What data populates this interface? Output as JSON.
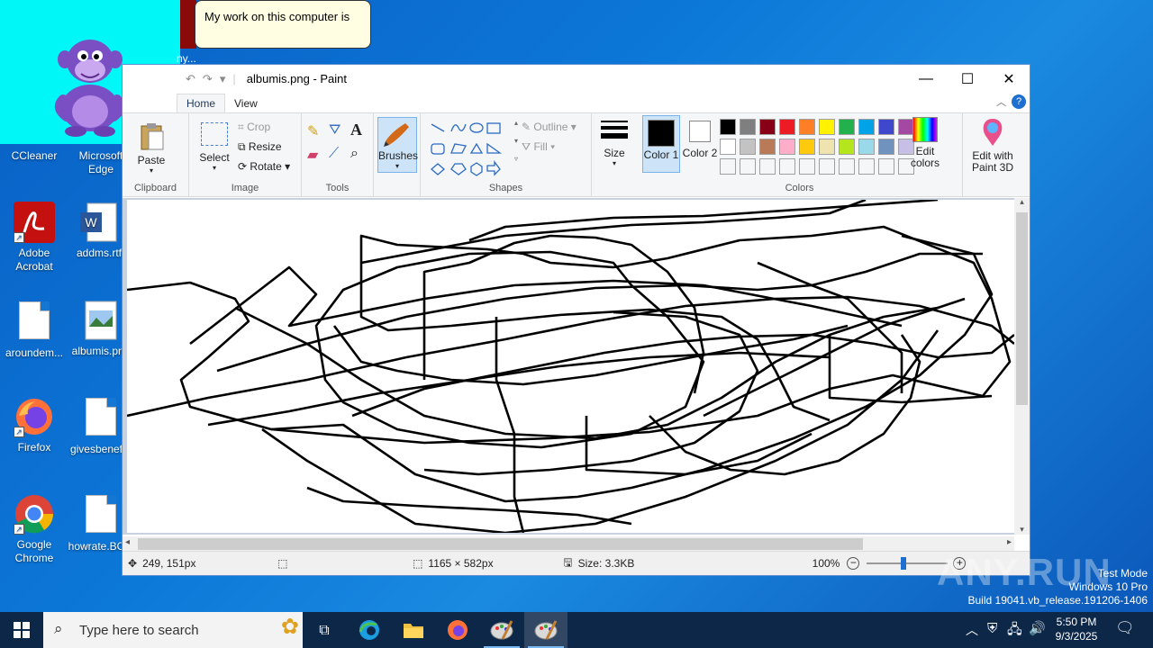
{
  "bonzi": {
    "bubble_text": "My work on this computer is",
    "tail_text": "ny..."
  },
  "desktop": {
    "icons": [
      {
        "label": "CCleaner"
      },
      {
        "label": "Microsoft Edge"
      },
      {
        "label": "Adobe Acrobat"
      },
      {
        "label": "addms.rtf"
      },
      {
        "label": "aroundem..."
      },
      {
        "label": "albumis.png"
      },
      {
        "label": "Firefox"
      },
      {
        "label": "givesbenef..."
      },
      {
        "label": "Google Chrome"
      },
      {
        "label": "howrate.BC..."
      }
    ]
  },
  "paint": {
    "title": "albumis.png - Paint",
    "tabs": [
      "Home",
      "View"
    ],
    "groups": {
      "clipboard": {
        "label": "Clipboard",
        "paste": "Paste"
      },
      "image": {
        "label": "Image",
        "select": "Select",
        "crop": "Crop",
        "resize": "Resize",
        "rotate": "Rotate"
      },
      "tools": {
        "label": "Tools"
      },
      "brushes": {
        "label": "Brushes"
      },
      "shapes": {
        "label": "Shapes",
        "outline": "Outline",
        "fill": "Fill"
      },
      "size": {
        "label": "Size"
      },
      "colors": {
        "label": "Colors",
        "color1": "Color 1",
        "color2": "Color 2",
        "edit_colors": "Edit colors"
      },
      "paint3d": {
        "label": "Edit with Paint 3D"
      }
    },
    "palette": [
      "#000000",
      "#7f7f7f",
      "#880015",
      "#ed1c24",
      "#ff7f27",
      "#fff200",
      "#22b14c",
      "#00a2e8",
      "#3f48cc",
      "#a349a4",
      "#ffffff",
      "#c3c3c3",
      "#b97a57",
      "#ffaec9",
      "#ffc90e",
      "#efe4b0",
      "#b5e61d",
      "#99d9ea",
      "#7092be",
      "#c8bfe7"
    ],
    "status": {
      "cursor_pos": "249, 151px",
      "image_size": "1165 × 582px",
      "file_size": "Size: 3.3KB",
      "zoom": "100%"
    }
  },
  "taskbar": {
    "search_placeholder": "Type here to search",
    "time": "5:50 PM",
    "date": "9/3/2025"
  },
  "watermark": {
    "brand": "ANY.RUN",
    "mode": "Test Mode",
    "edition": "Windows 10 Pro",
    "build": "Build 19041.vb_release.191206-1406"
  }
}
